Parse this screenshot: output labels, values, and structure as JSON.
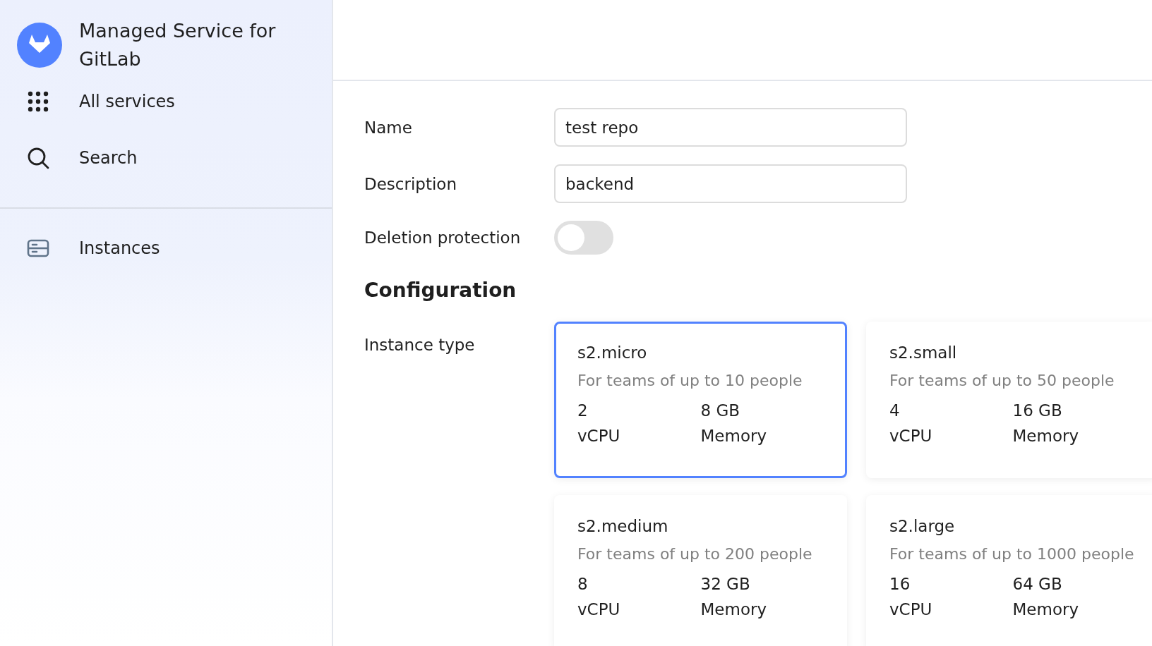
{
  "sidebar": {
    "title": "Managed Service for GitLab",
    "top_items": [
      {
        "label": "All services"
      },
      {
        "label": "Search"
      }
    ],
    "nav_items": [
      {
        "label": "Instances"
      }
    ]
  },
  "form": {
    "fields": [
      {
        "label": "Name",
        "value": "test repo"
      },
      {
        "label": "Description",
        "value": "backend"
      }
    ],
    "toggle": {
      "label": "Deletion protection",
      "on": false
    },
    "section_title": "Configuration",
    "instance_type": {
      "label": "Instance type",
      "options": [
        {
          "name": "s2.micro",
          "description": "For teams of up to 10 people",
          "cpu": "2",
          "cpu_unit": "vCPU",
          "memory": "8 GB",
          "memory_unit": "Memory",
          "selected": true
        },
        {
          "name": "s2.small",
          "description": "For teams of up to 50 people",
          "cpu": "4",
          "cpu_unit": "vCPU",
          "memory": "16 GB",
          "memory_unit": "Memory",
          "selected": false
        },
        {
          "name": "s2.medium",
          "description": "For teams of up to 200 people",
          "cpu": "8",
          "cpu_unit": "vCPU",
          "memory": "32 GB",
          "memory_unit": "Memory",
          "selected": false
        },
        {
          "name": "s2.large",
          "description": "For teams of up to 1000 people",
          "cpu": "16",
          "cpu_unit": "vCPU",
          "memory": "64 GB",
          "memory_unit": "Memory",
          "selected": false
        }
      ]
    }
  }
}
